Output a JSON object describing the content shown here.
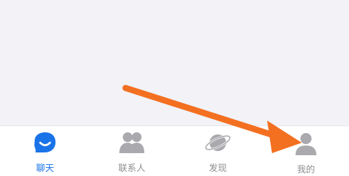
{
  "tabbar": {
    "items": [
      {
        "label": "聊天",
        "icon": "chat-bubble-icon",
        "active": true
      },
      {
        "label": "联系人",
        "icon": "contacts-icon",
        "active": false
      },
      {
        "label": "发现",
        "icon": "planet-icon",
        "active": false
      },
      {
        "label": "我的",
        "icon": "user-icon",
        "active": false
      }
    ]
  },
  "colors": {
    "active": "#1a73e8",
    "inactive": "#8e8e93",
    "icon_inactive": "#a9a9ae",
    "annotation_arrow": "#f37021",
    "background": "#f2f2f7"
  }
}
